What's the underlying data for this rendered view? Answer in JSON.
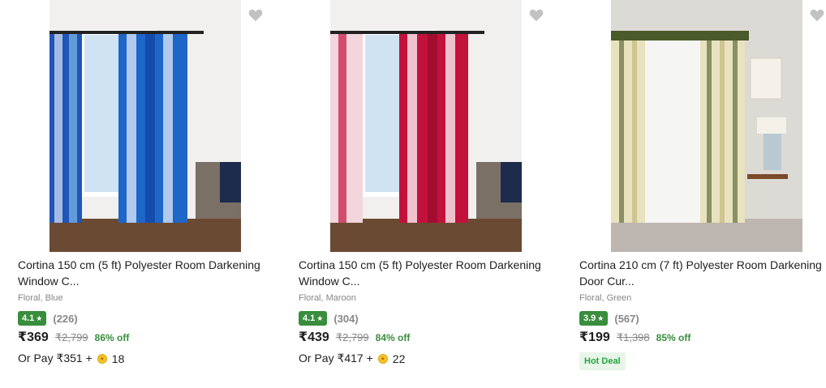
{
  "products": [
    {
      "title_line1": "Cortina 150 cm (5 ft) Polyester Room Darkening",
      "title_line2": "Window C...",
      "subtitle": "Floral, Blue",
      "rating": "4.1",
      "rating_count": "(226)",
      "price": "₹369",
      "mrp": "₹2,799",
      "discount": "86% off",
      "pay_prefix": "Or Pay ₹351 +",
      "coins": "18",
      "accent_color": "#1e66c8"
    },
    {
      "title_line1": "Cortina 150 cm (5 ft) Polyester Room Darkening",
      "title_line2": "Window C...",
      "subtitle": "Floral, Maroon",
      "rating": "4.1",
      "rating_count": "(304)",
      "price": "₹439",
      "mrp": "₹2,799",
      "discount": "84% off",
      "pay_prefix": "Or Pay ₹417 +",
      "coins": "22",
      "accent_color": "#c2123b"
    },
    {
      "title_line1": "Cortina 210 cm (7 ft) Polyester Room Darkening",
      "title_line2": "Door Cur...",
      "subtitle": "Floral, Green",
      "rating": "3.9",
      "rating_count": "(567)",
      "price": "₹199",
      "mrp": "₹1,398",
      "discount": "85% off",
      "deal_label": "Hot Deal",
      "accent_color": "#4a5a2a"
    }
  ],
  "icons": {
    "wishlist": "heart-icon",
    "rating": "star-icon",
    "coin": "supercoin-icon"
  },
  "colors": {
    "rating_badge": "#388e3c",
    "discount": "#388e3c",
    "muted": "#878787"
  }
}
